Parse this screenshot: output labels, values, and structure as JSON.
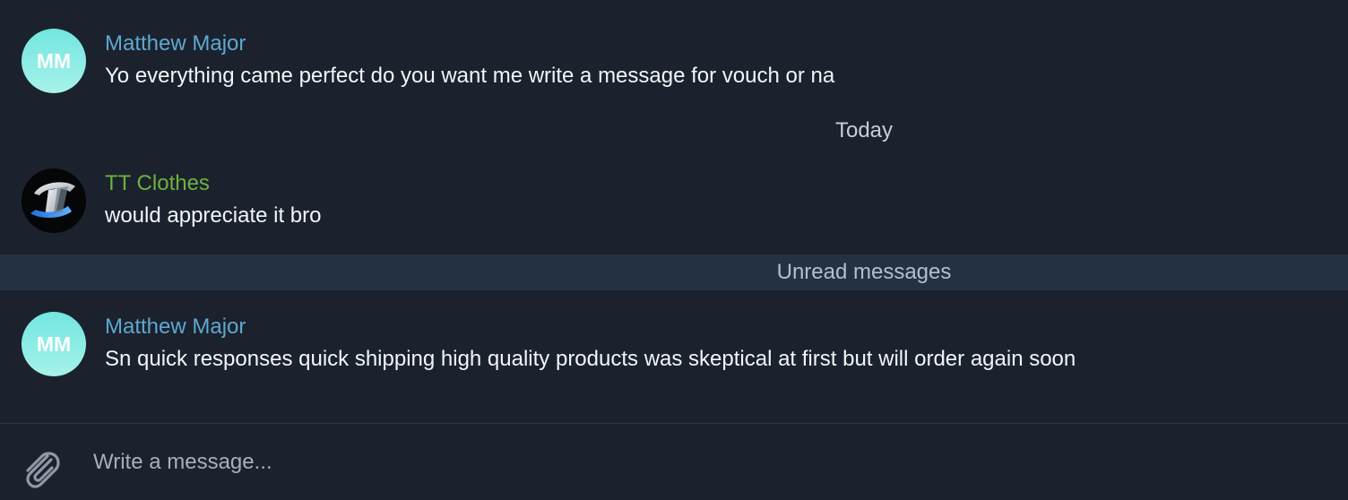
{
  "messages": [
    {
      "sender": "Matthew Major",
      "initials": "MM",
      "text": "Yo everything came perfect do you want me write a message for vouch or na",
      "avatar_style": "initials",
      "sender_color": "#5ea7cf"
    },
    {
      "sender": "TT Clothes",
      "text": "would appreciate it bro",
      "avatar_style": "logo",
      "sender_color": "#6cb13f"
    },
    {
      "sender": "Matthew Major",
      "initials": "MM",
      "text": "Sn quick responses quick shipping high quality products was skeptical at first but will order again soon",
      "avatar_style": "initials",
      "sender_color": "#5ea7cf"
    }
  ],
  "date_separator": "Today",
  "unread_separator": "Unread messages",
  "composer": {
    "placeholder": "Write a message...",
    "value": "",
    "attach_icon": "paperclip-icon"
  },
  "colors": {
    "background": "#1b222d",
    "unread_bar": "#243142",
    "avatar_gradient_top": "#72e6e0",
    "avatar_gradient_bottom": "#a6f2e9"
  }
}
